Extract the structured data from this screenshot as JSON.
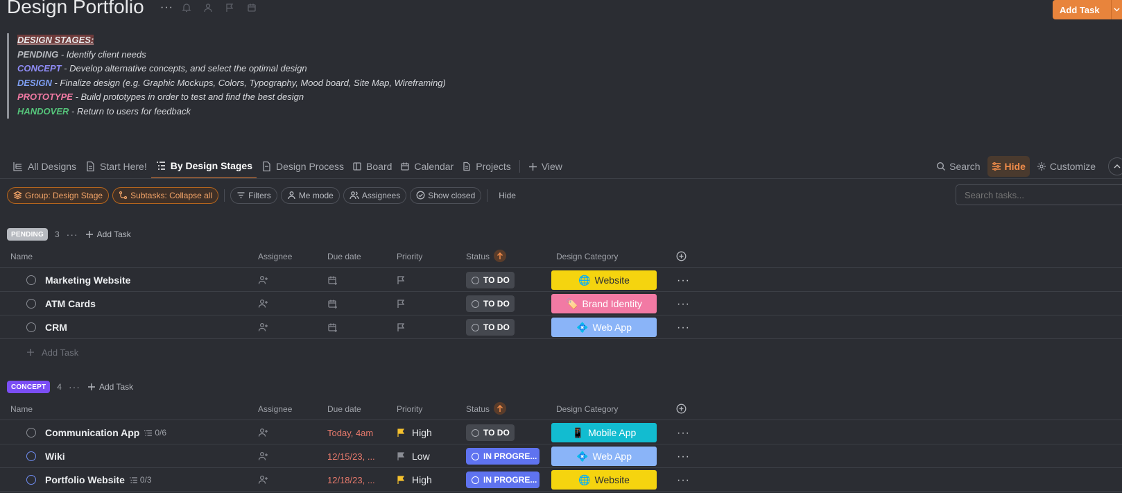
{
  "header": {
    "title": "Design Portfolio",
    "add_task_label": "Add Task"
  },
  "description": {
    "heading": "DESIGN STAGES:",
    "lines": [
      {
        "stage": "PENDING",
        "text": " - Identify client needs"
      },
      {
        "stage": "CONCEPT",
        "text": " - Develop alternative concepts, and select the optimal design"
      },
      {
        "stage": "DESIGN",
        "text": " - Finalize design (e.g. Graphic Mockups, Colors, Typography, Mood board, Site Map, Wireframing)"
      },
      {
        "stage": "PROTOTYPE",
        "text": " - Build prototypes in order to test and find the best design"
      },
      {
        "stage": "HANDOVER",
        "text": " - Return to users for feedback"
      }
    ]
  },
  "tabs": [
    {
      "label": "All Designs"
    },
    {
      "label": "Start Here!"
    },
    {
      "label": "By Design Stages"
    },
    {
      "label": "Design Process"
    },
    {
      "label": "Board"
    },
    {
      "label": "Calendar"
    },
    {
      "label": "Projects"
    },
    {
      "label": "View"
    }
  ],
  "tools": {
    "search": "Search",
    "hide": "Hide",
    "customize": "Customize"
  },
  "filters": {
    "group": "Group: Design Stage",
    "subtasks": "Subtasks: Collapse all",
    "filters": "Filters",
    "me_mode": "Me mode",
    "assignees": "Assignees",
    "show_closed": "Show closed",
    "hide": "Hide",
    "search_placeholder": "Search tasks..."
  },
  "columns": {
    "name": "Name",
    "assignee": "Assignee",
    "due": "Due date",
    "priority": "Priority",
    "status": "Status",
    "category": "Design Category"
  },
  "groups": [
    {
      "badge": "PENDING",
      "count": "3",
      "add_label": "Add Task",
      "tasks": [
        {
          "name": "Marketing Website",
          "status": "TO DO",
          "category": "Website"
        },
        {
          "name": "ATM Cards",
          "status": "TO DO",
          "category": "Brand Identity"
        },
        {
          "name": "CRM",
          "status": "TO DO",
          "category": "Web App"
        }
      ],
      "add_row_label": "Add Task"
    },
    {
      "badge": "CONCEPT",
      "count": "4",
      "add_label": "Add Task",
      "tasks": [
        {
          "name": "Communication App",
          "subtasks": "0/6",
          "due": "Today, 4am",
          "priority": "High",
          "status": "TO DO",
          "category": "Mobile App"
        },
        {
          "name": "Wiki",
          "due": "12/15/23, ...",
          "priority": "Low",
          "status": "IN PROGRE...",
          "category": "Web App"
        },
        {
          "name": "Portfolio Website",
          "subtasks": "0/3",
          "due": "12/18/23, ...",
          "priority": "High",
          "status": "IN PROGRE...",
          "category": "Website"
        }
      ]
    }
  ],
  "colors": {
    "accent": "#e8843c",
    "website": "#f5d40f",
    "brand_identity": "#f27aa4",
    "web_app": "#8ab4f8",
    "mobile_app": "#12bcd0",
    "high_flag": "#f5c12e",
    "low_flag": "#8a8d94"
  }
}
